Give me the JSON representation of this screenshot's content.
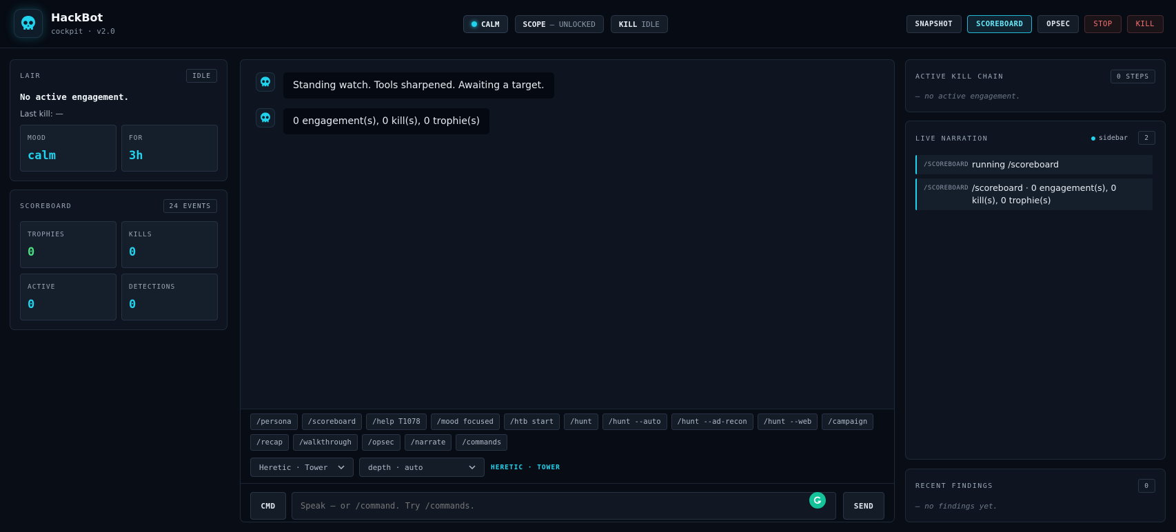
{
  "app": {
    "title": "HackBot",
    "subtitle": "cockpit · v2.0"
  },
  "status": {
    "mood": "CALM",
    "scope_label": "SCOPE",
    "scope_value": "— UNLOCKED",
    "kill_label": "KILL",
    "kill_value": "IDLE"
  },
  "actions": {
    "snapshot": "SNAPSHOT",
    "scoreboard": "SCOREBOARD",
    "opsec": "OPSEC",
    "stop": "STOP",
    "kill": "KILL"
  },
  "lair": {
    "title": "LAIR",
    "state": "IDLE",
    "headline": "No active engagement.",
    "last_kill": "Last kill: —",
    "mood_label": "MOOD",
    "mood_value": "calm",
    "for_label": "FOR",
    "for_value": "3h"
  },
  "scoreboard": {
    "title": "SCOREBOARD",
    "events": "24 EVENTS",
    "trophies_label": "TROPHIES",
    "trophies": "0",
    "kills_label": "KILLS",
    "kills": "0",
    "active_label": "ACTIVE",
    "active": "0",
    "detections_label": "DETECTIONS",
    "detections": "0"
  },
  "chat": {
    "messages": [
      "Standing watch. Tools sharpened. Awaiting a target.",
      "0 engagement(s), 0 kill(s), 0 trophie(s)"
    ],
    "chips": [
      "/persona",
      "/scoreboard",
      "/help T1078",
      "/mood focused",
      "/htb start",
      "/hunt",
      "/hunt --auto",
      "/hunt --ad-recon",
      "/hunt --web",
      "/campaign",
      "/recap",
      "/walkthrough",
      "/opsec",
      "/narrate",
      "/commands"
    ],
    "persona_select": "Heretic · Tower",
    "depth_select": "depth · auto",
    "persona_badge": "HERETIC · TOWER",
    "cmd_label": "CMD",
    "input_placeholder": "Speak — or /command. Try /commands.",
    "send_label": "SEND"
  },
  "kill_chain": {
    "title": "ACTIVE KILL CHAIN",
    "steps": "0 STEPS",
    "empty": "— no active engagement."
  },
  "narration": {
    "title": "LIVE NARRATION",
    "mode": "sidebar",
    "count": "2",
    "items": [
      {
        "tag": "/SCOREBOARD",
        "text": "running /scoreboard"
      },
      {
        "tag": "/SCOREBOARD",
        "text": "/scoreboard · 0 engagement(s), 0 kill(s), 0 trophie(s)"
      }
    ]
  },
  "findings": {
    "title": "RECENT FINDINGS",
    "count": "0",
    "empty": "— no findings yet."
  },
  "colors": {
    "accent": "#22d3ee",
    "good": "#4ade80",
    "danger": "#f87171"
  }
}
